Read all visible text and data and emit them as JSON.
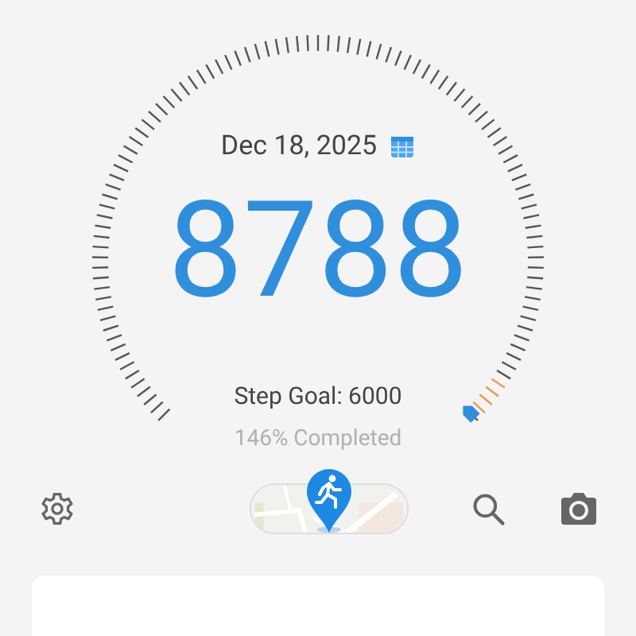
{
  "date": "Dec 18, 2025",
  "steps": "8788",
  "goal": "Step Goal: 6000",
  "completed": "146% Completed"
}
